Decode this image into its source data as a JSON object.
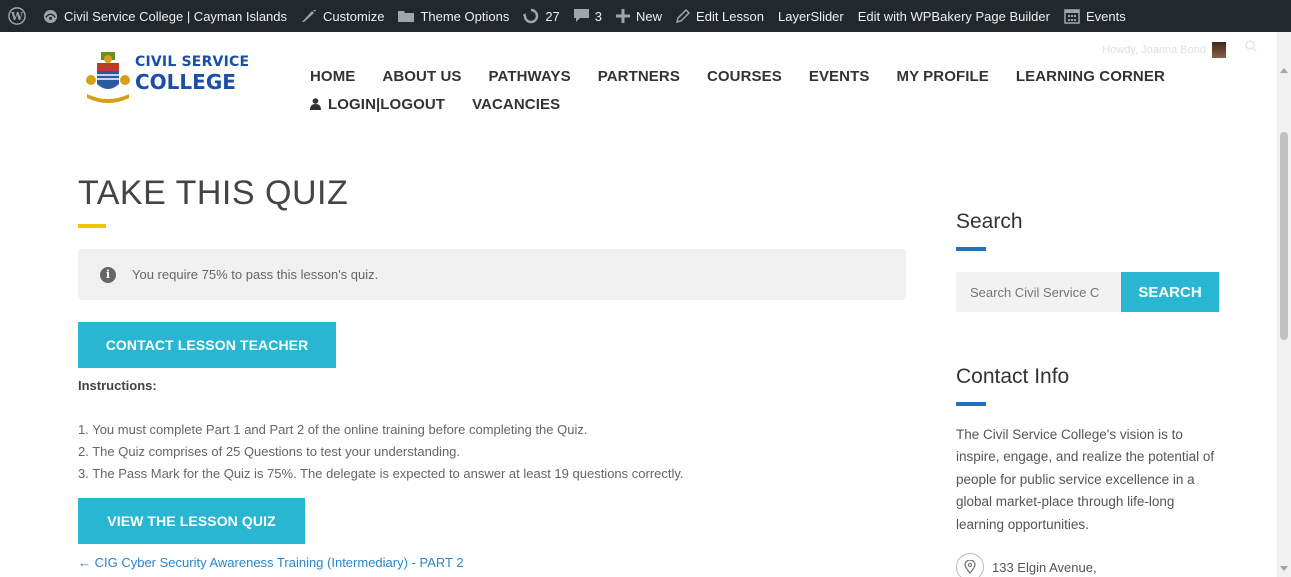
{
  "admin_bar": {
    "site_name": "Civil Service College | Cayman Islands",
    "customize": "Customize",
    "theme_options": "Theme Options",
    "updates_count": "27",
    "comments_count": "3",
    "new": "New",
    "edit_lesson": "Edit Lesson",
    "layerslider": "LayerSlider",
    "wpbakery": "Edit with WPBakery Page Builder",
    "events": "Events"
  },
  "header": {
    "logo_line1": "CIVIL SERVICE",
    "logo_line2": "COLLEGE",
    "howdy": "Howdy, Joanna Bond",
    "nav": [
      {
        "label": "HOME"
      },
      {
        "label": "ABOUT US"
      },
      {
        "label": "PATHWAYS"
      },
      {
        "label": "PARTNERS"
      },
      {
        "label": "COURSES"
      },
      {
        "label": "EVENTS"
      },
      {
        "label": "MY PROFILE"
      },
      {
        "label": "LEARNING CORNER"
      }
    ],
    "nav_row2": [
      {
        "label": "LOGIN|LOGOUT"
      },
      {
        "label": "VACANCIES"
      }
    ]
  },
  "main": {
    "title": "TAKE THIS QUIZ",
    "notice": "You require 75% to pass this lesson's quiz.",
    "contact_button": "CONTACT LESSON TEACHER",
    "instructions_label": "Instructions:",
    "instructions": [
      "1. You must complete Part 1 and Part 2 of the online training before completing the Quiz.",
      "2. The Quiz comprises of 25 Questions to test your understanding.",
      "3. The Pass Mark for the Quiz is 75%. The delegate is expected to answer at least 19 questions correctly."
    ],
    "quiz_button": "VIEW THE LESSON QUIZ",
    "prev_link": "← CIG Cyber Security Awareness Training (Intermediary) - PART 2"
  },
  "sidebar": {
    "search_heading": "Search",
    "search_placeholder": "Search Civil Service C",
    "search_button": "SEARCH",
    "contact_heading": "Contact Info",
    "contact_text": "The Civil Service College's vision is to inspire, engage, and realize the potential of people for public service excellence in a global market-place through life-long learning opportunities.",
    "address": "133 Elgin Avenue,"
  },
  "colors": {
    "accent_cyan": "#29b6d2",
    "title_underline": "#f5c400",
    "sidebar_underline": "#1f73be",
    "admin_bar": "#23282d"
  }
}
